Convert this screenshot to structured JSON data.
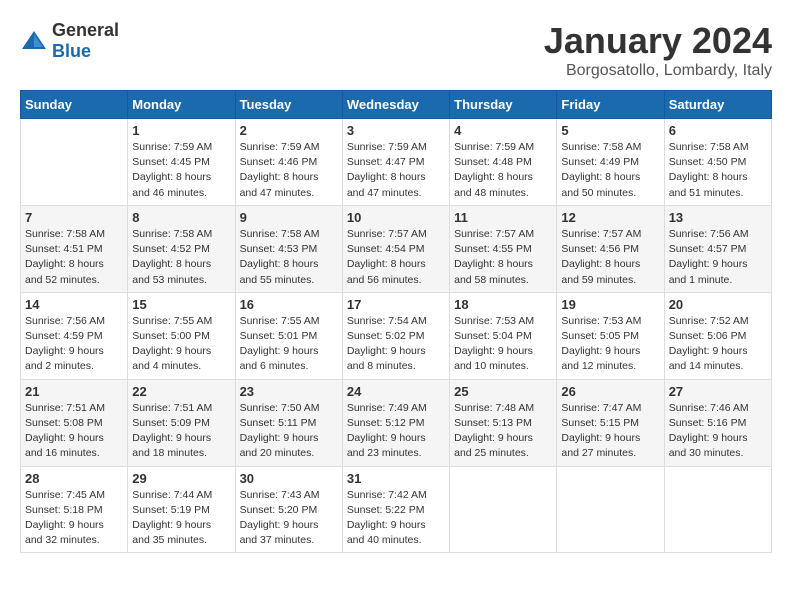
{
  "header": {
    "logo_general": "General",
    "logo_blue": "Blue",
    "month_title": "January 2024",
    "location": "Borgosatollo, Lombardy, Italy"
  },
  "weekdays": [
    "Sunday",
    "Monday",
    "Tuesday",
    "Wednesday",
    "Thursday",
    "Friday",
    "Saturday"
  ],
  "weeks": [
    [
      {
        "day": "",
        "info": ""
      },
      {
        "day": "1",
        "info": "Sunrise: 7:59 AM\nSunset: 4:45 PM\nDaylight: 8 hours\nand 46 minutes."
      },
      {
        "day": "2",
        "info": "Sunrise: 7:59 AM\nSunset: 4:46 PM\nDaylight: 8 hours\nand 47 minutes."
      },
      {
        "day": "3",
        "info": "Sunrise: 7:59 AM\nSunset: 4:47 PM\nDaylight: 8 hours\nand 47 minutes."
      },
      {
        "day": "4",
        "info": "Sunrise: 7:59 AM\nSunset: 4:48 PM\nDaylight: 8 hours\nand 48 minutes."
      },
      {
        "day": "5",
        "info": "Sunrise: 7:58 AM\nSunset: 4:49 PM\nDaylight: 8 hours\nand 50 minutes."
      },
      {
        "day": "6",
        "info": "Sunrise: 7:58 AM\nSunset: 4:50 PM\nDaylight: 8 hours\nand 51 minutes."
      }
    ],
    [
      {
        "day": "7",
        "info": "Sunrise: 7:58 AM\nSunset: 4:51 PM\nDaylight: 8 hours\nand 52 minutes."
      },
      {
        "day": "8",
        "info": "Sunrise: 7:58 AM\nSunset: 4:52 PM\nDaylight: 8 hours\nand 53 minutes."
      },
      {
        "day": "9",
        "info": "Sunrise: 7:58 AM\nSunset: 4:53 PM\nDaylight: 8 hours\nand 55 minutes."
      },
      {
        "day": "10",
        "info": "Sunrise: 7:57 AM\nSunset: 4:54 PM\nDaylight: 8 hours\nand 56 minutes."
      },
      {
        "day": "11",
        "info": "Sunrise: 7:57 AM\nSunset: 4:55 PM\nDaylight: 8 hours\nand 58 minutes."
      },
      {
        "day": "12",
        "info": "Sunrise: 7:57 AM\nSunset: 4:56 PM\nDaylight: 8 hours\nand 59 minutes."
      },
      {
        "day": "13",
        "info": "Sunrise: 7:56 AM\nSunset: 4:57 PM\nDaylight: 9 hours\nand 1 minute."
      }
    ],
    [
      {
        "day": "14",
        "info": "Sunrise: 7:56 AM\nSunset: 4:59 PM\nDaylight: 9 hours\nand 2 minutes."
      },
      {
        "day": "15",
        "info": "Sunrise: 7:55 AM\nSunset: 5:00 PM\nDaylight: 9 hours\nand 4 minutes."
      },
      {
        "day": "16",
        "info": "Sunrise: 7:55 AM\nSunset: 5:01 PM\nDaylight: 9 hours\nand 6 minutes."
      },
      {
        "day": "17",
        "info": "Sunrise: 7:54 AM\nSunset: 5:02 PM\nDaylight: 9 hours\nand 8 minutes."
      },
      {
        "day": "18",
        "info": "Sunrise: 7:53 AM\nSunset: 5:04 PM\nDaylight: 9 hours\nand 10 minutes."
      },
      {
        "day": "19",
        "info": "Sunrise: 7:53 AM\nSunset: 5:05 PM\nDaylight: 9 hours\nand 12 minutes."
      },
      {
        "day": "20",
        "info": "Sunrise: 7:52 AM\nSunset: 5:06 PM\nDaylight: 9 hours\nand 14 minutes."
      }
    ],
    [
      {
        "day": "21",
        "info": "Sunrise: 7:51 AM\nSunset: 5:08 PM\nDaylight: 9 hours\nand 16 minutes."
      },
      {
        "day": "22",
        "info": "Sunrise: 7:51 AM\nSunset: 5:09 PM\nDaylight: 9 hours\nand 18 minutes."
      },
      {
        "day": "23",
        "info": "Sunrise: 7:50 AM\nSunset: 5:11 PM\nDaylight: 9 hours\nand 20 minutes."
      },
      {
        "day": "24",
        "info": "Sunrise: 7:49 AM\nSunset: 5:12 PM\nDaylight: 9 hours\nand 23 minutes."
      },
      {
        "day": "25",
        "info": "Sunrise: 7:48 AM\nSunset: 5:13 PM\nDaylight: 9 hours\nand 25 minutes."
      },
      {
        "day": "26",
        "info": "Sunrise: 7:47 AM\nSunset: 5:15 PM\nDaylight: 9 hours\nand 27 minutes."
      },
      {
        "day": "27",
        "info": "Sunrise: 7:46 AM\nSunset: 5:16 PM\nDaylight: 9 hours\nand 30 minutes."
      }
    ],
    [
      {
        "day": "28",
        "info": "Sunrise: 7:45 AM\nSunset: 5:18 PM\nDaylight: 9 hours\nand 32 minutes."
      },
      {
        "day": "29",
        "info": "Sunrise: 7:44 AM\nSunset: 5:19 PM\nDaylight: 9 hours\nand 35 minutes."
      },
      {
        "day": "30",
        "info": "Sunrise: 7:43 AM\nSunset: 5:20 PM\nDaylight: 9 hours\nand 37 minutes."
      },
      {
        "day": "31",
        "info": "Sunrise: 7:42 AM\nSunset: 5:22 PM\nDaylight: 9 hours\nand 40 minutes."
      },
      {
        "day": "",
        "info": ""
      },
      {
        "day": "",
        "info": ""
      },
      {
        "day": "",
        "info": ""
      }
    ]
  ]
}
